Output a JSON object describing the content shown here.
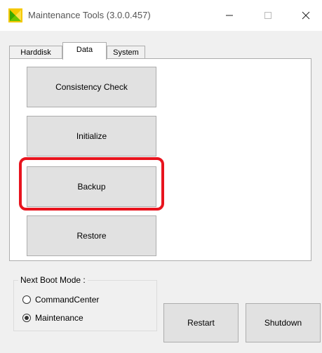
{
  "window": {
    "title": "Maintenance Tools (3.0.0.457)",
    "icon": "app-logo-icon",
    "controls": [
      "minimize-icon",
      "maximize-icon",
      "close-icon"
    ]
  },
  "tabs": [
    {
      "label": "Harddisk",
      "active": false
    },
    {
      "label": "Data",
      "active": true
    },
    {
      "label": "System",
      "active": false
    }
  ],
  "data_tab": {
    "buttons": [
      "Consistency Check",
      "Initialize",
      "Backup",
      "Restore"
    ],
    "highlighted_button": "Backup",
    "highlight_color": "#e8141e"
  },
  "boot_mode": {
    "label": "Next Boot Mode :",
    "options": [
      {
        "label": "CommandCenter",
        "checked": false
      },
      {
        "label": "Maintenance",
        "checked": true
      }
    ]
  },
  "footer": {
    "restart_label": "Restart",
    "shutdown_label": "Shutdown"
  }
}
